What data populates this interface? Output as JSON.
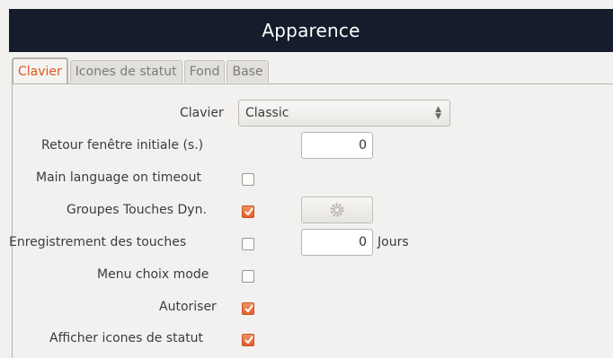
{
  "window": {
    "title": "Apparence"
  },
  "tabs": [
    {
      "label": "Clavier",
      "active": true
    },
    {
      "label": "Icones de statut",
      "active": false
    },
    {
      "label": "Fond",
      "active": false
    },
    {
      "label": "Base",
      "active": false
    }
  ],
  "form": {
    "clavier": {
      "label": "Clavier",
      "value": "Classic"
    },
    "retour": {
      "label": "Retour fenêtre initiale (s.)",
      "value": "0"
    },
    "main_language": {
      "label": "Main language on timeout",
      "checked": false
    },
    "groupes": {
      "label": "Groupes Touches Dyn.",
      "checked": true,
      "button_icon": "gear-icon"
    },
    "enregistrement": {
      "label": "Enregistrement des touches",
      "checked": false,
      "value": "0",
      "unit": "Jours"
    },
    "menu_choix": {
      "label": "Menu choix mode",
      "checked": false
    },
    "autoriser": {
      "label": "Autoriser",
      "checked": true
    },
    "afficher": {
      "label": "Afficher icones de statut",
      "checked": true
    }
  },
  "colors": {
    "accent": "#e05a1e",
    "titlebar": "#151c2b"
  }
}
